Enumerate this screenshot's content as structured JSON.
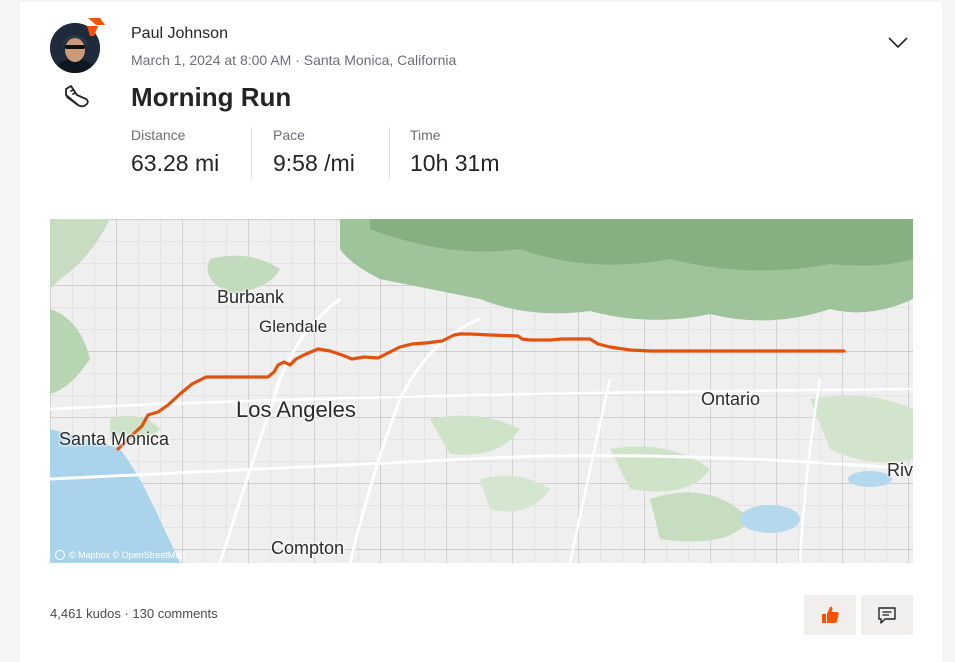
{
  "athlete": {
    "name": "Paul Johnson",
    "avatar_icon": "avatar-photo",
    "badge_icon": "subscriber-badge-icon"
  },
  "activity": {
    "meta": "March 1, 2024 at 8:00 AM · Santa Monica, California",
    "title": "Morning Run",
    "sport_icon": "running-shoe-icon"
  },
  "stats": [
    {
      "label": "Distance",
      "value": "63.28 mi"
    },
    {
      "label": "Pace",
      "value": "9:58 /mi"
    },
    {
      "label": "Time",
      "value": "10h 31m"
    }
  ],
  "map": {
    "labels": {
      "burbank": "Burbank",
      "glendale": "Glendale",
      "los_angeles": "Los Angeles",
      "santa_monica": "Santa Monica",
      "ontario": "Ontario",
      "compton": "Compton",
      "riverside": "Riv"
    },
    "attribution": "© Mapbox © OpenStreetMap",
    "route_color": "#e2520f"
  },
  "social": {
    "summary": "4,461 kudos · 130 comments"
  },
  "colors": {
    "accent": "#fc5200",
    "text": "#242428",
    "muted": "#6d6d78"
  }
}
